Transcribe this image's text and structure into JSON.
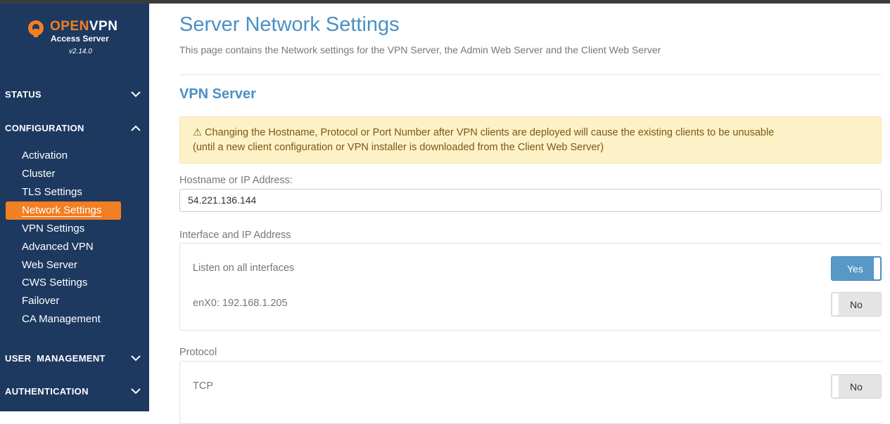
{
  "brand": {
    "name_part1": "OPEN",
    "name_part2": "VPN",
    "subtitle": "Access Server",
    "version": "v2.14.0"
  },
  "sidebar": {
    "sections": [
      {
        "label": "STATUS",
        "expanded": false
      },
      {
        "label": "CONFIGURATION",
        "expanded": true
      },
      {
        "label": "USER  MANAGEMENT",
        "expanded": false
      },
      {
        "label": "AUTHENTICATION",
        "expanded": false
      }
    ],
    "config_items": [
      {
        "label": "Activation"
      },
      {
        "label": "Cluster"
      },
      {
        "label": "TLS Settings"
      },
      {
        "label": "Network Settings",
        "active": true
      },
      {
        "label": "VPN Settings"
      },
      {
        "label": "Advanced VPN"
      },
      {
        "label": "Web Server"
      },
      {
        "label": "CWS Settings"
      },
      {
        "label": "Failover"
      },
      {
        "label": "CA Management"
      }
    ]
  },
  "page": {
    "title": "Server Network Settings",
    "description": "This page contains the Network settings for the VPN Server, the Admin Web Server and the Client Web Server",
    "vpn_server": {
      "title": "VPN Server",
      "warning_line1": "⚠ Changing the Hostname, Protocol or Port Number after VPN clients are deployed will cause the existing clients to be unusable",
      "warning_line2": "(until a new client configuration or VPN installer is downloaded from the Client Web Server)",
      "hostname_label": "Hostname or IP Address:",
      "hostname_value": "54.221.136.144",
      "interface_label": "Interface and IP Address",
      "interfaces": [
        {
          "label": "Listen on all interfaces",
          "toggle": "Yes"
        },
        {
          "label": "enX0: 192.168.1.205",
          "toggle": "No"
        }
      ],
      "protocol_label": "Protocol",
      "protocols": [
        {
          "label": "TCP",
          "toggle": "No"
        }
      ]
    }
  },
  "colors": {
    "sidebar_bg": "#1d3960",
    "accent_orange": "#f17f23",
    "title_blue": "#4b8fc3",
    "toggle_yes": "#5898c6",
    "warning_bg": "#fdf1c8"
  }
}
